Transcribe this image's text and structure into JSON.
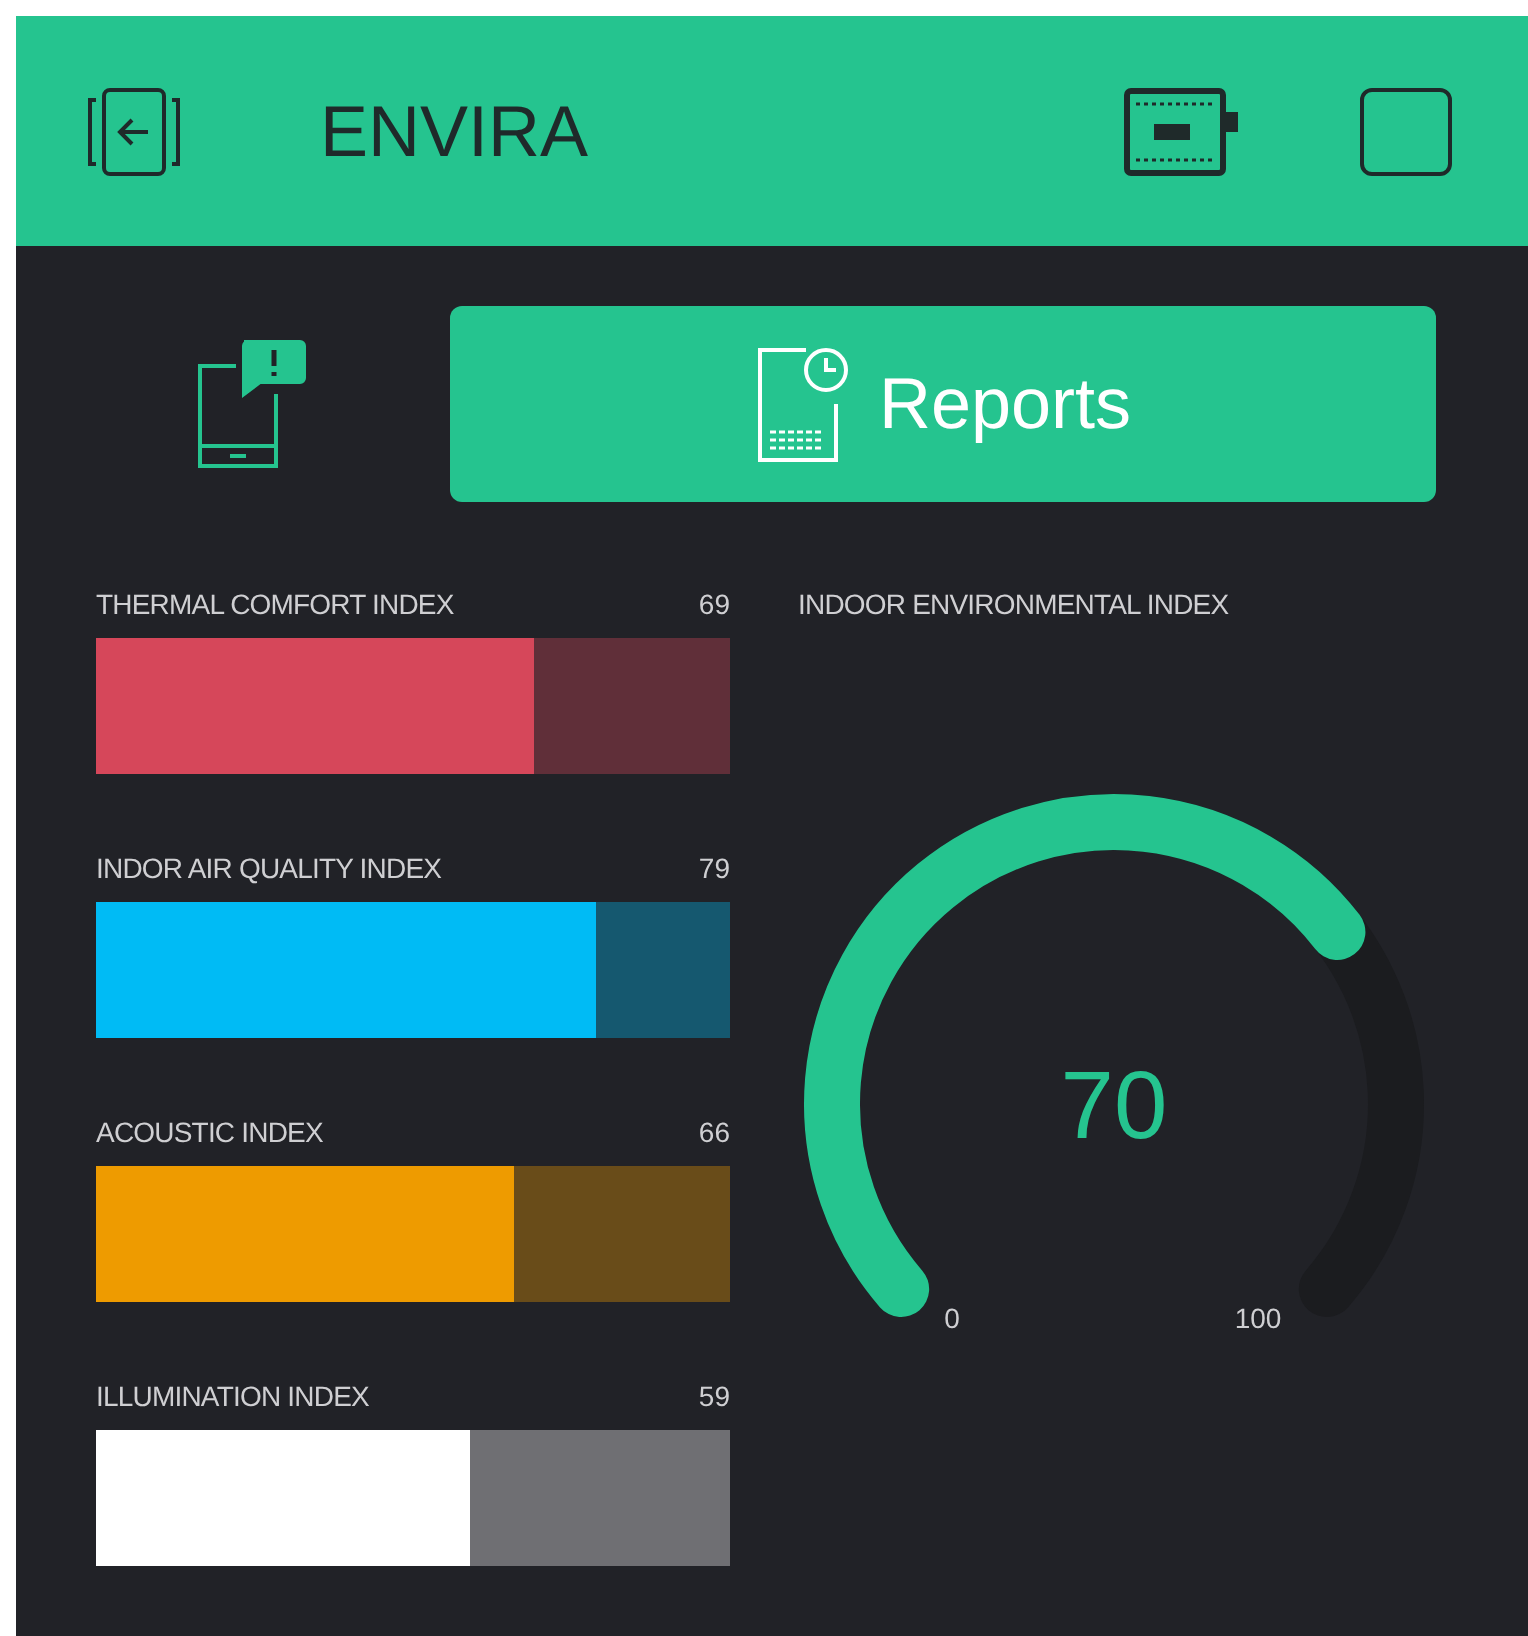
{
  "header": {
    "title": "ENVIRA"
  },
  "reports_button": {
    "label": "Reports"
  },
  "indices": [
    {
      "name": "THERMAL COMFORT INDEX",
      "value": "69",
      "level": 0.69,
      "color": "#d6475a"
    },
    {
      "name": "INDOR AIR QUALITY INDEX",
      "value": "79",
      "level": 0.79,
      "color": "#00bbf5"
    },
    {
      "name": "ACOUSTIC INDEX",
      "value": "66",
      "level": 0.66,
      "color": "#ee9b00"
    },
    {
      "name": "ILLUMINATION INDEX",
      "value": "59",
      "level": 0.59,
      "color": "#ffffff"
    }
  ],
  "gauge": {
    "title": "INDOOR ENVIRONMENTAL INDEX",
    "value": "70",
    "min": "0",
    "max": "100"
  }
}
